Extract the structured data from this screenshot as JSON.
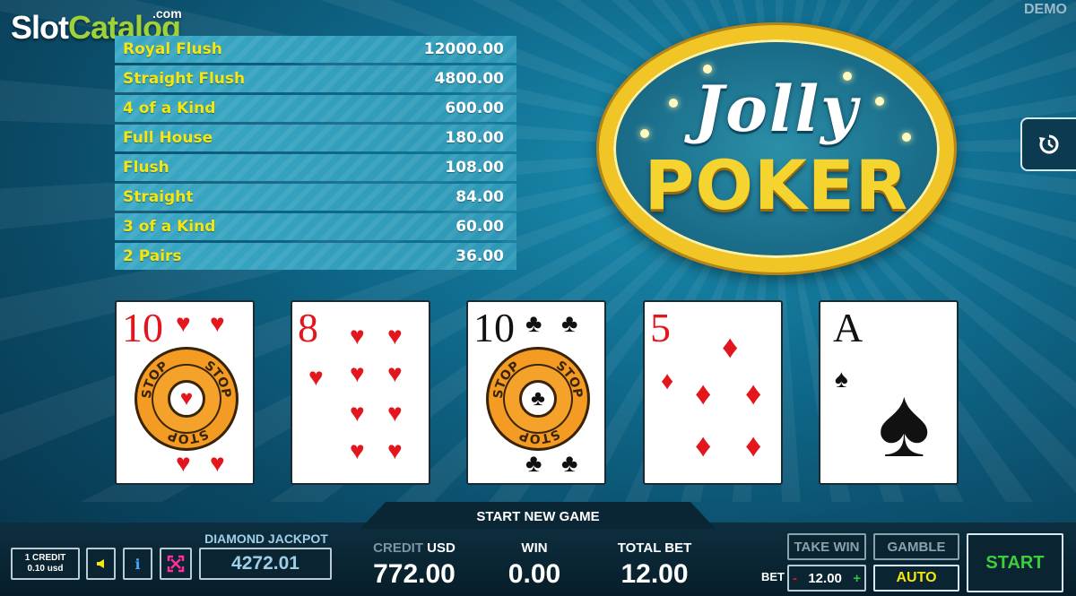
{
  "watermark": {
    "part1": "Slot",
    "part2": "Catalog",
    "domain": ".com"
  },
  "mode_label": "DEMO",
  "paytable": [
    {
      "hand": "Royal Flush",
      "amount": "12000.00"
    },
    {
      "hand": "Straight Flush",
      "amount": "4800.00"
    },
    {
      "hand": "4 of a Kind",
      "amount": "600.00"
    },
    {
      "hand": "Full House",
      "amount": "180.00"
    },
    {
      "hand": "Flush",
      "amount": "108.00"
    },
    {
      "hand": "Straight",
      "amount": "84.00"
    },
    {
      "hand": "3 of a Kind",
      "amount": "60.00"
    },
    {
      "hand": "2 Pairs",
      "amount": "36.00"
    }
  ],
  "logo": {
    "line1": "Jolly",
    "line2": "POKER"
  },
  "cards": [
    {
      "rank": "10",
      "suit": "heart",
      "suit_symbol": "♥",
      "color": "red",
      "held": true,
      "hold_label": "STOP"
    },
    {
      "rank": "8",
      "suit": "heart",
      "suit_symbol": "♥",
      "color": "red",
      "held": false
    },
    {
      "rank": "10",
      "suit": "club",
      "suit_symbol": "♣",
      "color": "black",
      "held": true,
      "hold_label": "STOP"
    },
    {
      "rank": "5",
      "suit": "diamond",
      "suit_symbol": "♦",
      "color": "red",
      "held": false
    },
    {
      "rank": "A",
      "suit": "spade",
      "suit_symbol": "♠",
      "color": "black",
      "held": false
    }
  ],
  "bottom": {
    "start_new_game": "START NEW GAME",
    "credit_btn": {
      "line1": "1 CREDIT",
      "line2": "0.10 usd"
    },
    "sound_icon": "speaker-icon",
    "info_label": "i",
    "fullscreen_icon": "fullscreen-icon",
    "jackpot": {
      "label": "DIAMOND JACKPOT",
      "value": "4272.01"
    },
    "credit": {
      "label_prefix": "CREDIT",
      "label_unit": "USD",
      "value": "772.00"
    },
    "win": {
      "label": "WIN",
      "value": "0.00"
    },
    "total_bet": {
      "label": "TOTAL BET",
      "value": "12.00"
    },
    "take_win": "TAKE WIN",
    "gamble": "GAMBLE",
    "bet": {
      "label": "BET",
      "minus": "-",
      "value": "12.00",
      "plus": "+"
    },
    "auto": "AUTO",
    "start": "START"
  },
  "colors": {
    "accent_yellow": "#f4e612",
    "start_green": "#3ccf3c",
    "card_red": "#e4161d",
    "logo_gold": "#f1c525"
  }
}
